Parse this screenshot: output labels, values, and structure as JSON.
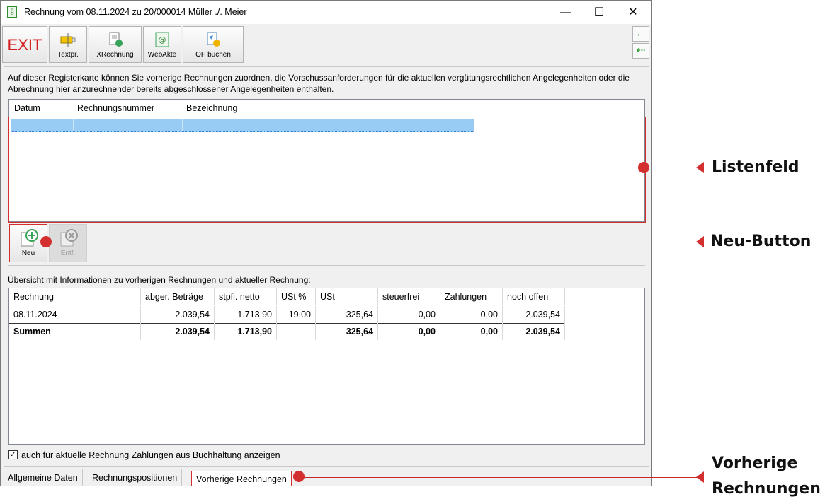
{
  "window": {
    "title": "Rechnung vom 08.11.2024 zu 20/000014  Müller ./. Meier",
    "app_icon": "§",
    "controls": {
      "minimize": "—",
      "maximize": "☐",
      "close": "✕"
    }
  },
  "toolbar": {
    "exit_label": "EXIT",
    "buttons": [
      {
        "label": "Textpr.",
        "icon": "text-template-icon"
      },
      {
        "label": "XRechnung",
        "icon": "xrechnung-document-icon"
      },
      {
        "label": "WebAkte",
        "icon": "webakte-icon"
      },
      {
        "label": "OP buchen",
        "icon": "book-payment-icon"
      }
    ],
    "side_arrows": [
      "←",
      "⇠"
    ]
  },
  "intro_text": "Auf dieser Registerkarte können Sie vorherige Rechnungen zuordnen, die Vorschussanforderungen für die aktuellen vergütungsrechtlichen Angelegenheiten oder die Abrechnung hier anzurechnender bereits abgeschlossener Angelegenheiten enthalten.",
  "list": {
    "columns": [
      "Datum",
      "Rechnungsnummer",
      "Bezeichnung"
    ]
  },
  "list_buttons": {
    "new_label": "Neu",
    "delete_label": "Entf."
  },
  "overview": {
    "label": "Übersicht mit Informationen zu vorherigen Rechnungen und aktueller Rechnung:",
    "columns": [
      "Rechnung",
      "abger. Beträge",
      "stpfl. netto",
      "USt %",
      "USt",
      "steuerfrei",
      "Zahlungen",
      "noch offen"
    ],
    "rows": [
      [
        "08.11.2024",
        "2.039,54",
        "1.713,90",
        "19,00",
        "325,64",
        "0,00",
        "0,00",
        "2.039,54"
      ],
      [
        "Summen",
        "2.039,54",
        "1.713,90",
        "",
        "325,64",
        "0,00",
        "0,00",
        "2.039,54"
      ]
    ]
  },
  "checkbox": {
    "checked": true,
    "label": "auch für aktuelle Rechnung Zahlungen aus Buchhaltung anzeigen"
  },
  "tabs": [
    "Allgemeine Daten",
    "Rechnungspositionen",
    "Vorherige Rechnungen"
  ],
  "active_tab": "Vorherige Rechnungen",
  "annotations": {
    "list": "Listenfeld",
    "new_button": "Neu-Button",
    "tab_line1": "Vorherige",
    "tab_line2": "Rechnungen"
  },
  "colors": {
    "accent_red": "#d32f2f",
    "selection_blue": "#99ccf5",
    "exit_red": "#d21f1f"
  }
}
